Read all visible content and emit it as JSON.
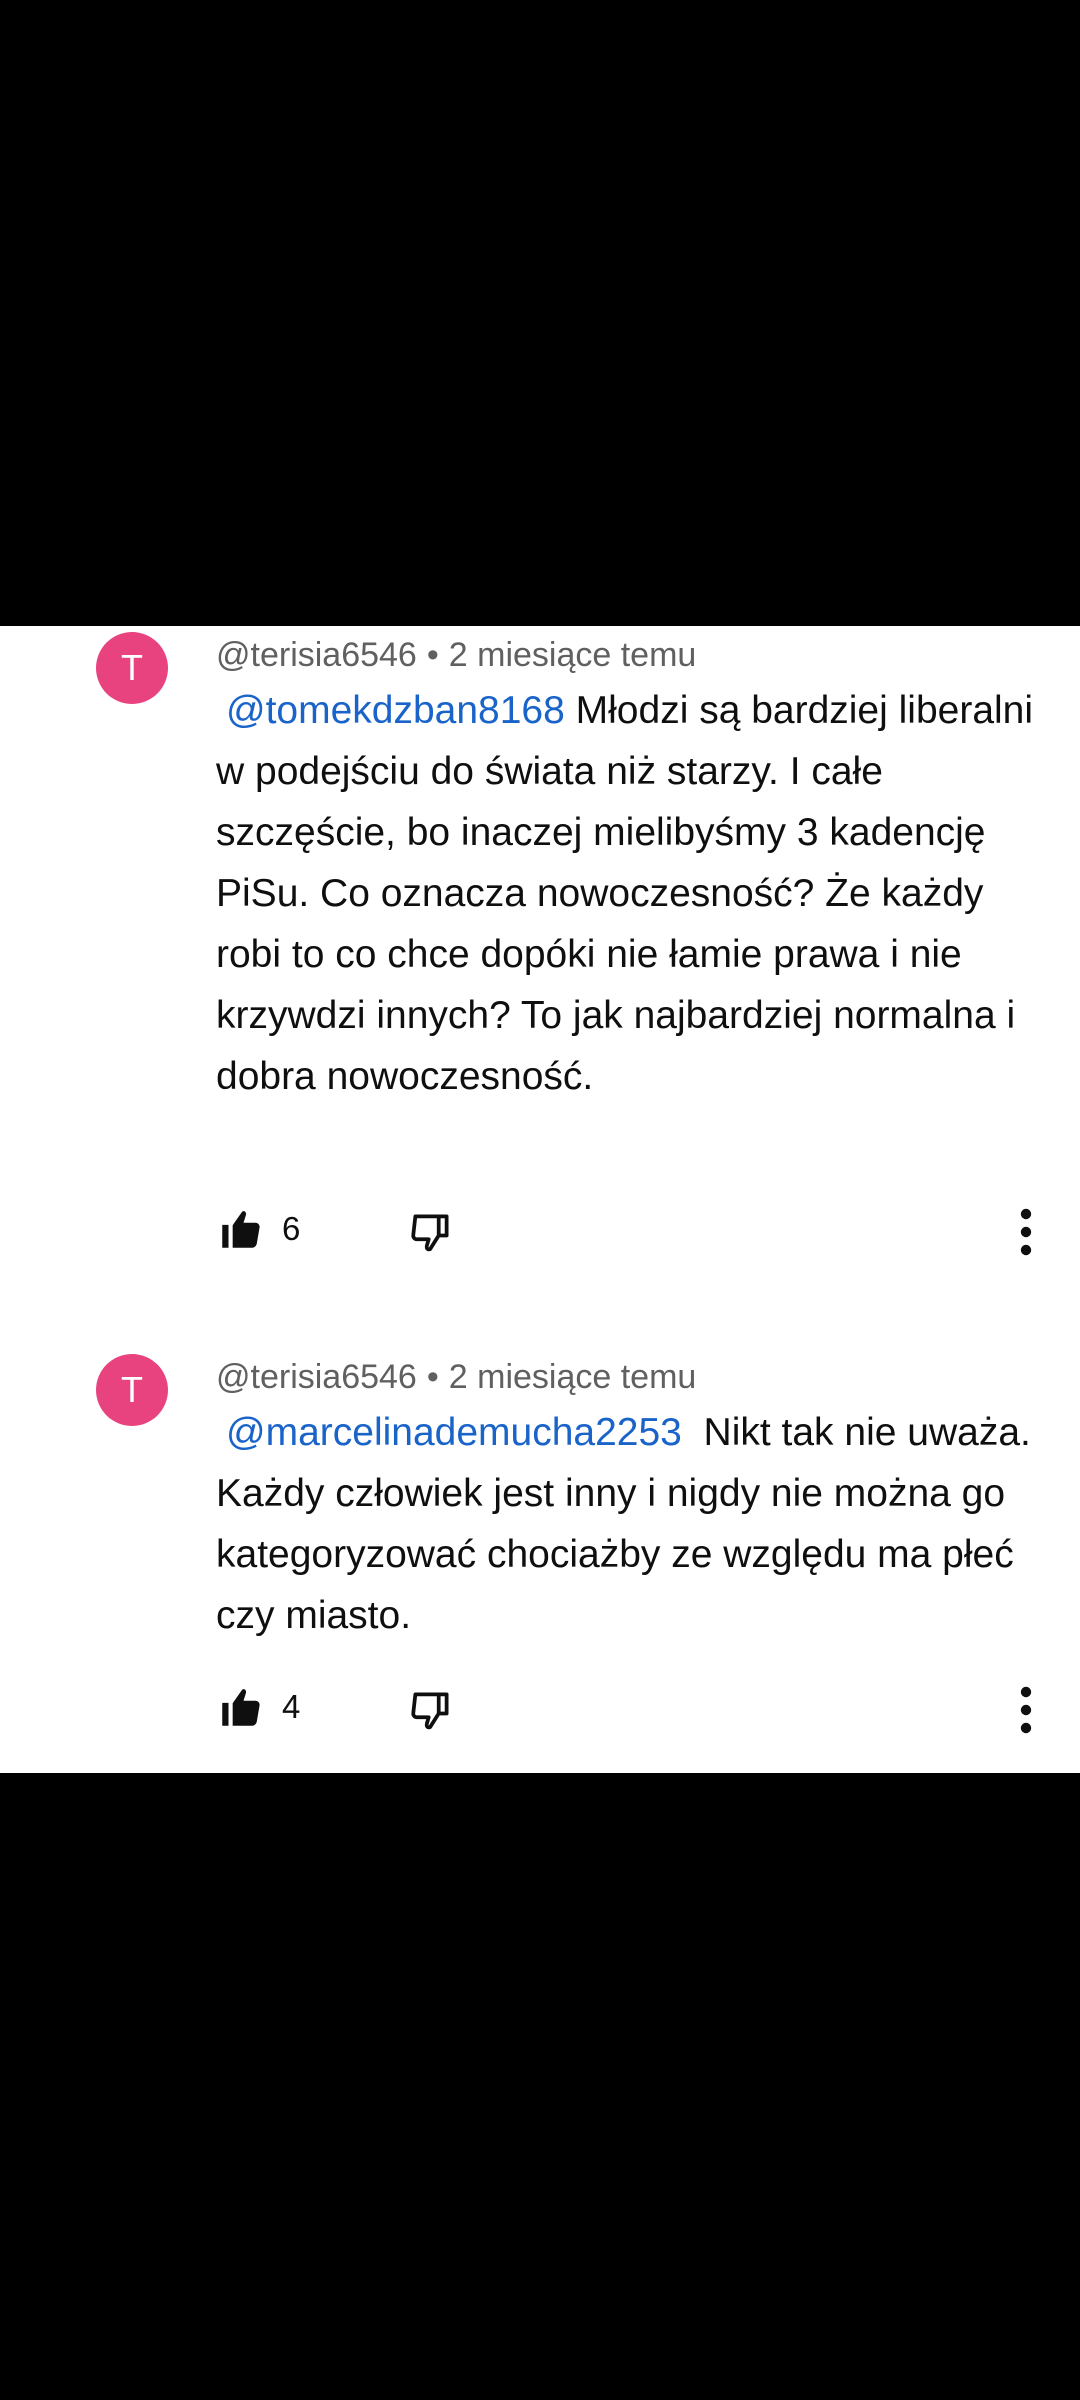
{
  "comments": [
    {
      "avatar_letter": "T",
      "author": "@terisia6546",
      "separator": "•",
      "time": "2 miesiące temu",
      "mention": "@tomekdzban8168",
      "text": "Młodzi są bardziej liberalni w podejściu do świata niż starzy. I całe szczęście, bo inaczej mielibyśmy 3 kadencję PiSu. Co oznacza nowoczesność? Że każdy robi to co chce dopóki nie łamie prawa i nie krzywdzi innych? To jak najbardziej normalna i dobra nowoczesność.",
      "likes": "6"
    },
    {
      "avatar_letter": "T",
      "author": "@terisia6546",
      "separator": "•",
      "time": "2 miesiące temu",
      "mention": "@marcelinademucha2253",
      "text": "Nikt tak nie uważa. Każdy człowiek jest inny i nigdy nie można go kategoryzować chociażby ze względu ma płeć czy miasto.",
      "likes": "4"
    }
  ],
  "colors": {
    "avatar": "#e8437e",
    "mention": "#1a64c9",
    "meta": "#606060",
    "text": "#0f0f0f"
  },
  "icons": {
    "like": "thumb-up-filled-icon",
    "dislike": "thumb-down-outline-icon",
    "more": "more-vertical-icon"
  }
}
